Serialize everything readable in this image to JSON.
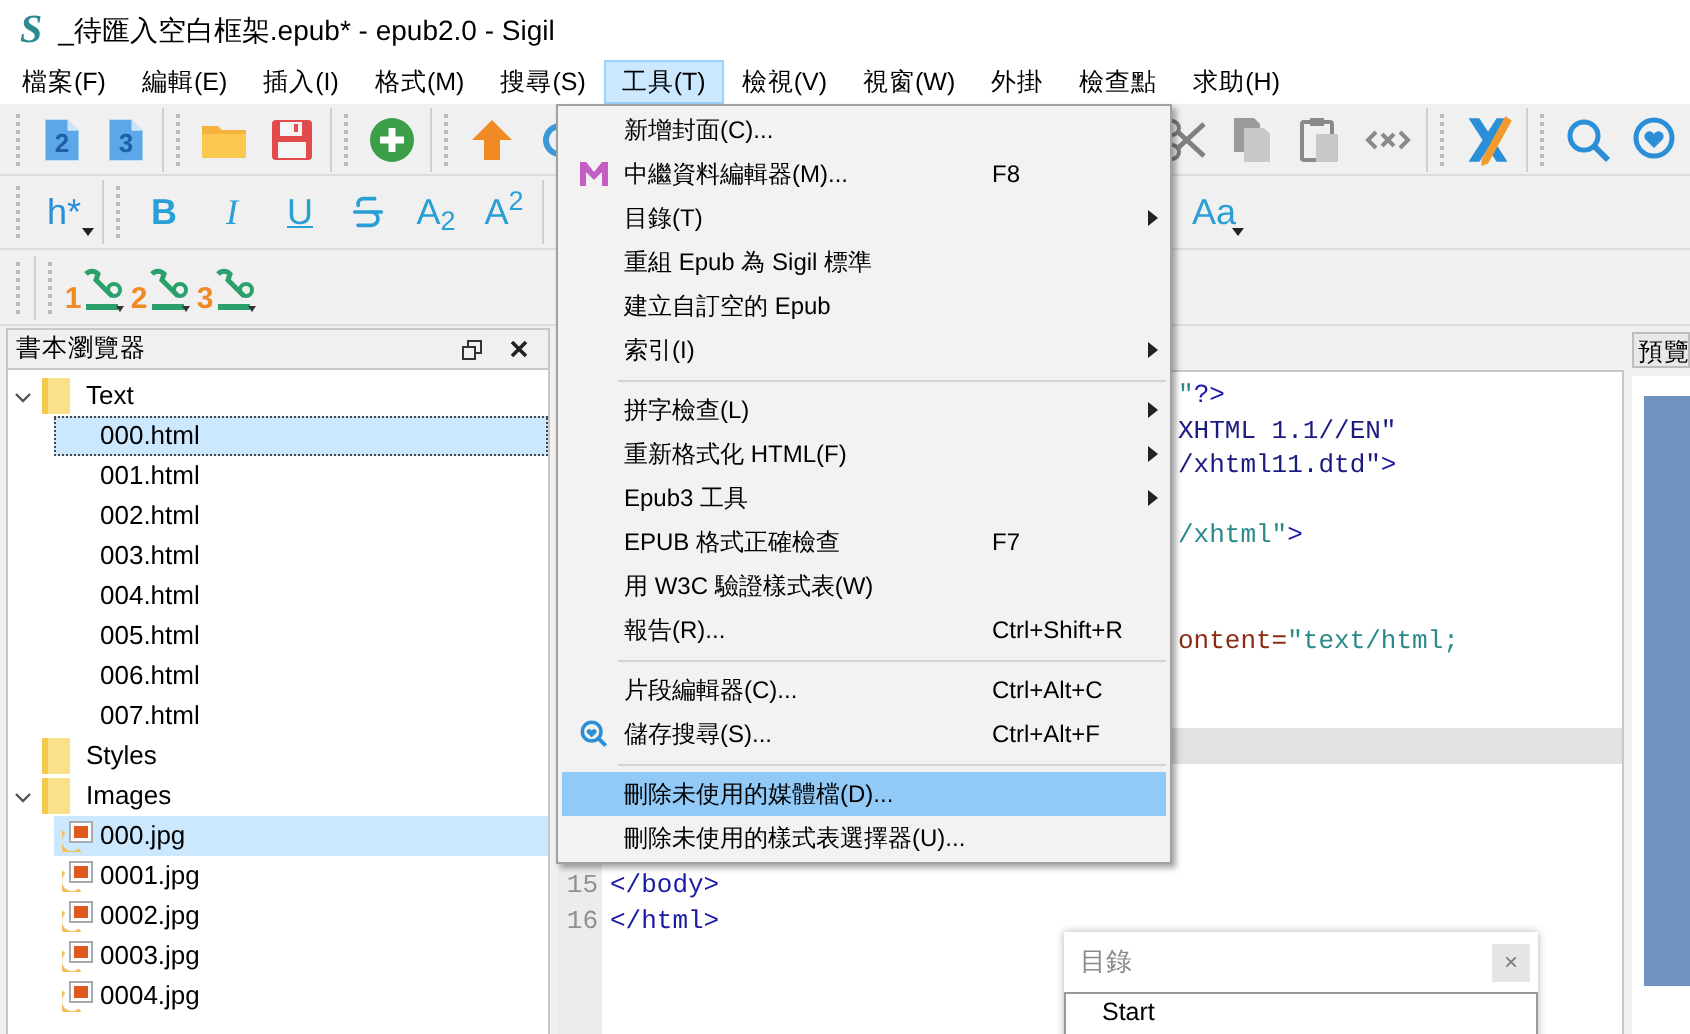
{
  "window": {
    "logo": "S",
    "title": "_待匯入空白框架.epub* - epub2.0 - Sigil"
  },
  "menubar": [
    {
      "label": "檔案(F)",
      "selected": false
    },
    {
      "label": "編輯(E)",
      "selected": false
    },
    {
      "label": "插入(I)",
      "selected": false
    },
    {
      "label": "格式(M)",
      "selected": false
    },
    {
      "label": "搜尋(S)",
      "selected": false
    },
    {
      "label": "工具(T)",
      "selected": true
    },
    {
      "label": "檢視(V)",
      "selected": false
    },
    {
      "label": "視窗(W)",
      "selected": false
    },
    {
      "label": "外掛",
      "selected": false
    },
    {
      "label": "檢查點",
      "selected": false
    },
    {
      "label": "求助(H)",
      "selected": false
    }
  ],
  "toolbar_1": {
    "left": [
      {
        "kind": "grip"
      },
      {
        "kind": "doc",
        "label": "2"
      },
      {
        "kind": "doc",
        "label": "3"
      },
      {
        "kind": "sep"
      },
      {
        "kind": "grip"
      },
      {
        "kind": "folder"
      },
      {
        "kind": "save"
      },
      {
        "kind": "sep"
      },
      {
        "kind": "grip"
      },
      {
        "kind": "add"
      },
      {
        "kind": "sep"
      },
      {
        "kind": "grip"
      },
      {
        "kind": "up"
      },
      {
        "kind": "redo"
      }
    ],
    "right": [
      {
        "kind": "grip"
      },
      {
        "kind": "cut"
      },
      {
        "kind": "copy"
      },
      {
        "kind": "paste"
      },
      {
        "kind": "code"
      },
      {
        "kind": "sep"
      },
      {
        "kind": "grip"
      },
      {
        "kind": "validate"
      },
      {
        "kind": "sep"
      },
      {
        "kind": "grip"
      },
      {
        "kind": "search"
      },
      {
        "kind": "saved-search"
      }
    ]
  },
  "toolbar_2": {
    "left": [
      {
        "kind": "grip"
      },
      {
        "kind": "heading",
        "label": "h*"
      },
      {
        "kind": "sep"
      },
      {
        "kind": "grip"
      },
      {
        "kind": "bold",
        "label": "B"
      },
      {
        "kind": "italic",
        "label": "I"
      },
      {
        "kind": "underline",
        "label": "U"
      },
      {
        "kind": "strike"
      },
      {
        "kind": "plain",
        "label": "A$_{2}$"
      },
      {
        "kind": "plain",
        "label": "A$^{2}$"
      },
      {
        "kind": "sep"
      },
      {
        "kind": "grip"
      }
    ],
    "right": [
      {
        "kind": "case",
        "label": "Aa"
      }
    ]
  },
  "toolbar_3": [
    {
      "kind": "grip"
    },
    {
      "kind": "sep"
    },
    {
      "kind": "grip"
    },
    {
      "kind": "plugin",
      "label": "1"
    },
    {
      "kind": "plugin",
      "label": "2"
    },
    {
      "kind": "plugin",
      "label": "3"
    }
  ],
  "book_browser": {
    "title": "書本瀏覽器",
    "tree": [
      {
        "label": "Text",
        "expanded": true,
        "children": [
          {
            "label": "000.html",
            "kind": "html",
            "selected": true,
            "focused": true
          },
          {
            "label": "001.html",
            "kind": "html",
            "selected": false,
            "focused": false
          },
          {
            "label": "002.html",
            "kind": "html",
            "selected": false,
            "focused": false
          },
          {
            "label": "003.html",
            "kind": "html",
            "selected": false,
            "focused": false
          },
          {
            "label": "004.html",
            "kind": "html",
            "selected": false,
            "focused": false
          },
          {
            "label": "005.html",
            "kind": "html",
            "selected": false,
            "focused": false
          },
          {
            "label": "006.html",
            "kind": "html",
            "selected": false,
            "focused": false
          },
          {
            "label": "007.html",
            "kind": "html",
            "selected": false,
            "focused": false
          }
        ]
      },
      {
        "label": "Styles"
      },
      {
        "label": "Images",
        "expanded": true,
        "children": [
          {
            "label": "000.jpg",
            "kind": "image",
            "selected": true,
            "focused": false
          },
          {
            "label": "0001.jpg",
            "kind": "image",
            "selected": false,
            "focused": false
          },
          {
            "label": "0002.jpg",
            "kind": "image",
            "selected": false,
            "focused": false
          },
          {
            "label": "0003.jpg",
            "kind": "image",
            "selected": false,
            "focused": false
          },
          {
            "label": "0004.jpg",
            "kind": "image",
            "selected": false,
            "focused": false
          }
        ]
      }
    ]
  },
  "editor": {
    "lines": [
      {
        "current": false,
        "segments": [
          {
            "text": "\"",
            "kind": "string"
          },
          {
            "text": "?>",
            "kind": "tag"
          }
        ]
      },
      {
        "current": false,
        "segments": [
          {
            "text": "XHTML 1.1//EN\"",
            "kind": "doctype"
          }
        ]
      },
      {
        "current": false,
        "segments": [
          {
            "text": "/xhtml11.dtd\"",
            "kind": "doctype"
          },
          {
            "text": ">",
            "kind": "tag"
          }
        ]
      },
      {
        "current": false
      },
      {
        "current": false,
        "segments": [
          {
            "text": "/xhtml\"",
            "kind": "string"
          },
          {
            "text": ">",
            "kind": "tag"
          }
        ]
      },
      {
        "current": false
      },
      {
        "current": false
      },
      {
        "current": false,
        "segments": [
          {
            "text": "ontent=",
            "kind": "attr"
          },
          {
            "text": "\"text/html;",
            "kind": "string"
          }
        ]
      },
      {
        "current": false
      },
      {
        "current": false
      },
      {
        "current": true
      },
      {
        "current": false
      },
      {
        "current": false
      },
      {
        "current": false
      },
      {
        "current": false,
        "number": "15",
        "segments": [
          {
            "text": "</body>",
            "kind": "tag"
          }
        ]
      },
      {
        "current": false,
        "number": "16",
        "segments": [
          {
            "text": "</html>",
            "kind": "tag"
          }
        ]
      }
    ]
  },
  "preview": {
    "title": "預覽"
  },
  "tools_menu": [
    {
      "kind": "item",
      "label": "新增封面(C)...",
      "selected": false
    },
    {
      "kind": "logo",
      "label": "中繼資料編輯器(M)...",
      "shortcut": "F8",
      "selected": false
    },
    {
      "kind": "item",
      "label": "目錄(T)",
      "submenu": true,
      "selected": false
    },
    {
      "kind": "item",
      "label": "重組 Epub 為 Sigil 標準",
      "selected": false
    },
    {
      "kind": "item",
      "label": "建立自訂空的 Epub",
      "selected": false
    },
    {
      "kind": "item",
      "label": "索引(I)",
      "submenu": true,
      "selected": false
    },
    {
      "kind": "separator"
    },
    {
      "kind": "item",
      "label": "拼字檢查(L)",
      "submenu": true,
      "selected": false
    },
    {
      "kind": "item",
      "label": "重新格式化 HTML(F)",
      "submenu": true,
      "selected": false
    },
    {
      "kind": "item",
      "label": "Epub3 工具",
      "submenu": true,
      "selected": false
    },
    {
      "kind": "item",
      "label": "EPUB 格式正確檢查",
      "shortcut": "F7",
      "selected": false
    },
    {
      "kind": "item",
      "label": "用 W3C 驗證樣式表(W)",
      "selected": false
    },
    {
      "kind": "item",
      "label": "報告(R)...",
      "shortcut": "Ctrl+Shift+R",
      "selected": false
    },
    {
      "kind": "separator"
    },
    {
      "kind": "item",
      "label": "片段編輯器(C)...",
      "shortcut": "Ctrl+Alt+C",
      "selected": false
    },
    {
      "kind": "search",
      "label": "儲存搜尋(S)...",
      "shortcut": "Ctrl+Alt+F",
      "selected": false
    },
    {
      "kind": "separator"
    },
    {
      "kind": "item",
      "label": "刪除未使用的媒體檔(D)...",
      "selected": true
    },
    {
      "kind": "item",
      "label": "刪除未使用的樣式表選擇器(U)...",
      "selected": false
    }
  ],
  "toc_window": {
    "title": "目錄",
    "close": "×",
    "items": [
      "Start"
    ]
  }
}
